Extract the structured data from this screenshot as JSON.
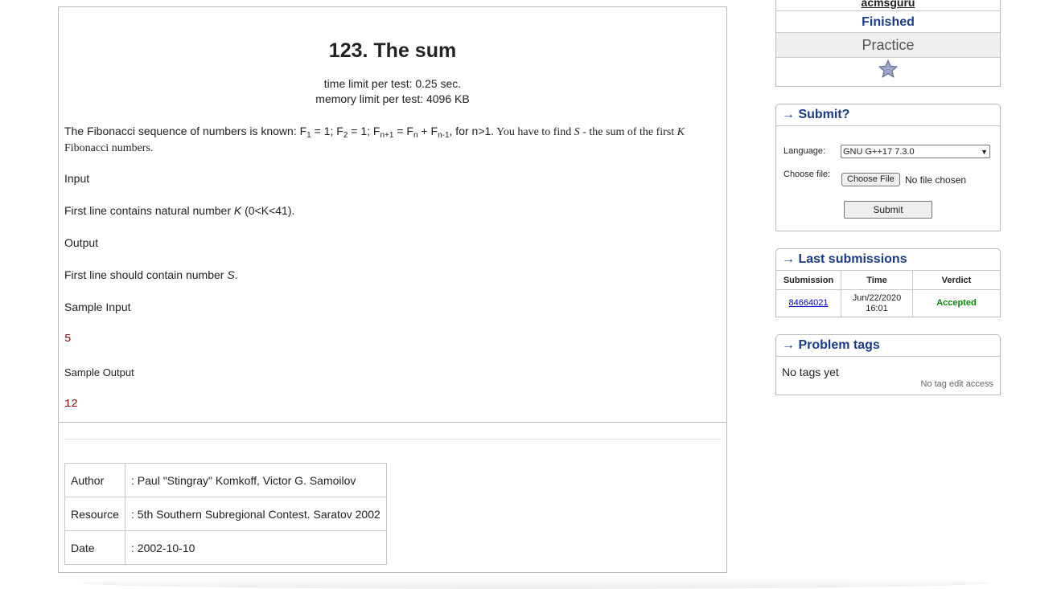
{
  "problem": {
    "title": "123. The sum",
    "time_limit": "time limit per test: 0.25 sec.",
    "memory_limit": "memory limit per test: 4096 KB",
    "statement_prefix": "The Fibonacci sequence of numbers is known: ",
    "formula": {
      "f1": "F",
      "f1_sub": "1",
      "f1_val": " = 1; ",
      "f2": "F",
      "f2_sub": "2",
      "f2_val": " = 1; ",
      "fn1": "F",
      "fn1_sub": "n+1",
      "eq": " = ",
      "fn": "F",
      "fn_sub": "n",
      "plus": " + ",
      "fnm1": "F",
      "fnm1_sub": "n-1",
      "cond": ", for n>1."
    },
    "statement_serif": " You have to find ",
    "var_s": "S",
    "statement_serif2": " - the sum of the first ",
    "var_k": "K",
    "statement_serif3": " Fibonacci numbers.",
    "input_heading": "Input",
    "input_text_prefix": "First line contains natural number ",
    "input_var": "K",
    "input_text_suffix": " (0<K<41).",
    "output_heading": "Output",
    "output_text_prefix": "First line should contain number ",
    "output_var": "S",
    "output_text_suffix": ".",
    "sample_input_heading": "Sample Input",
    "sample_input": "5",
    "sample_output_heading": "Sample Output",
    "sample_output": "12",
    "meta": [
      {
        "key": "Author",
        "value": ": Paul \"Stingray\" Komkoff, Victor G. Samoilov"
      },
      {
        "key": "Resource",
        "value": ": 5th Southern Subregional Contest. Saratov 2002"
      },
      {
        "key": "Date",
        "value": ": 2002-10-10"
      }
    ]
  },
  "sidebar": {
    "contest_name": "acmsguru",
    "contest_status": "Finished",
    "practice_label": "Practice",
    "star_icon": "star-icon",
    "submit": {
      "heading": "→ Submit?",
      "language_label": "Language:",
      "language_value": "GNU G++17 7.3.0",
      "file_label": "Choose file:",
      "file_button": "Choose File",
      "file_none": "No file chosen",
      "submit_button": "Submit"
    },
    "last_submissions": {
      "heading": "→ Last submissions",
      "columns": [
        "Submission",
        "Time",
        "Verdict"
      ],
      "rows": [
        {
          "id": "84664021",
          "time": "Jun/22/2020 16:01",
          "verdict": "Accepted"
        }
      ]
    },
    "tags": {
      "heading": "→ Problem tags",
      "empty_text": "No tags yet",
      "access_note": "No tag edit access"
    }
  },
  "colors": {
    "header_blue": "#1a3a8a",
    "accepted_green": "#0a8a0a",
    "sample_red": "#8b0000"
  }
}
